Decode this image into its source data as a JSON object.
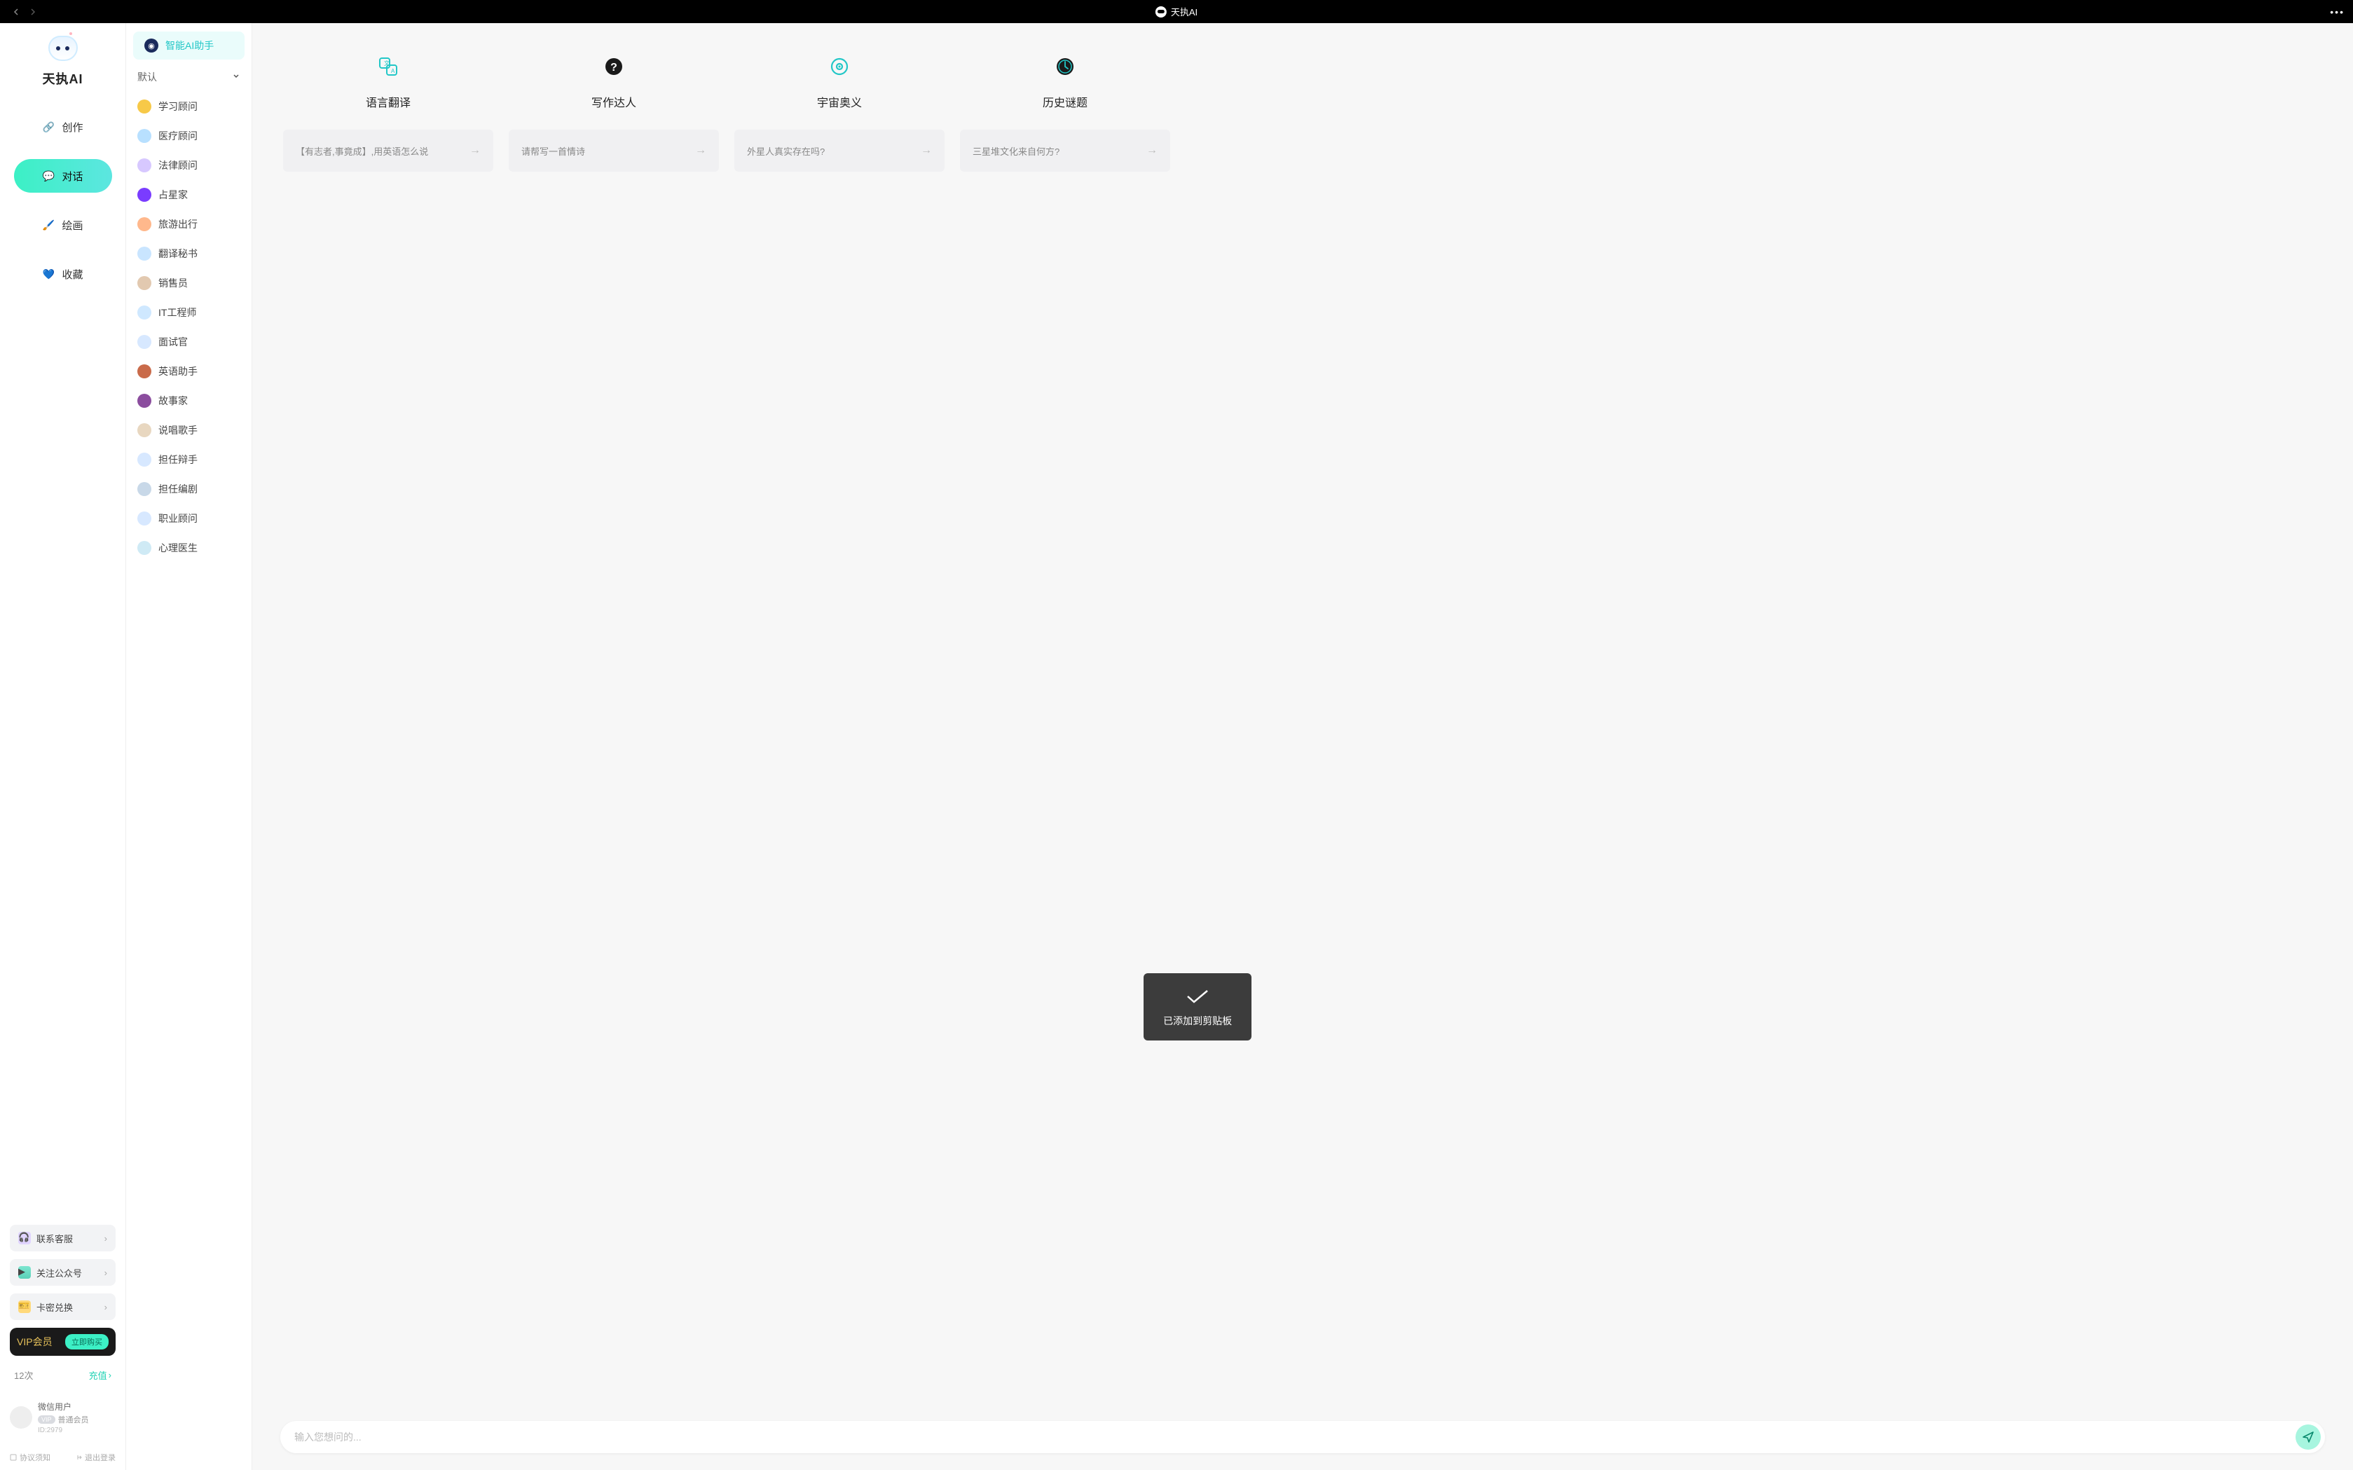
{
  "titlebar": {
    "title": "天执AI"
  },
  "app": {
    "name": "天执AI"
  },
  "nav": {
    "items": [
      {
        "label": "创作",
        "active": false
      },
      {
        "label": "对话",
        "active": true
      },
      {
        "label": "绘画",
        "active": false
      },
      {
        "label": "收藏",
        "active": false
      }
    ]
  },
  "bottom": {
    "contact": "联系客服",
    "follow": "关注公众号",
    "redeem": "卡密兑换",
    "vip_label": "VIP会员",
    "vip_buy": "立即购买",
    "credit": "12次",
    "recharge": "充值"
  },
  "user": {
    "name": "微信用户",
    "level_badge": "VIP",
    "level_text": "普通会员",
    "id": "ID:2979"
  },
  "footer": {
    "terms": "协议须知",
    "logout": "退出登录"
  },
  "assistant_header": "智能AI助手",
  "assistant_group": "默认",
  "assistants": [
    {
      "label": "学习顾问",
      "color": "#f7c948"
    },
    {
      "label": "医疗顾问",
      "color": "#b8e0ff"
    },
    {
      "label": "法律顾问",
      "color": "#d7c8ff"
    },
    {
      "label": "占星家",
      "color": "#7a3cff"
    },
    {
      "label": "旅游出行",
      "color": "#ffb88c"
    },
    {
      "label": "翻译秘书",
      "color": "#c9e5ff"
    },
    {
      "label": "销售员",
      "color": "#e2c9b0"
    },
    {
      "label": "IT工程师",
      "color": "#cfe8ff"
    },
    {
      "label": "面试官",
      "color": "#d7e8ff"
    },
    {
      "label": "英语助手",
      "color": "#c96b4a"
    },
    {
      "label": "故事家",
      "color": "#8b4d9e"
    },
    {
      "label": "说唱歌手",
      "color": "#e8d7c0"
    },
    {
      "label": "担任辩手",
      "color": "#d7e8ff"
    },
    {
      "label": "担任编剧",
      "color": "#c8d8e8"
    },
    {
      "label": "职业顾问",
      "color": "#d7e8ff"
    },
    {
      "label": "心理医生",
      "color": "#cfeaf5"
    }
  ],
  "cards": [
    {
      "title": "语言翻译",
      "prompt": "【有志者,事竟成】,用英语怎么说",
      "icon_color": "#22c7c7"
    },
    {
      "title": "写作达人",
      "prompt": "请帮写一首情诗",
      "icon_color": "#1a1a1a"
    },
    {
      "title": "宇宙奥义",
      "prompt": "外星人真实存在吗?",
      "icon_color": "#22c7c7"
    },
    {
      "title": "历史谜题",
      "prompt": "三星堆文化来自何方?",
      "icon_color": "#1a1a1a"
    }
  ],
  "toast": "已添加到剪贴板",
  "input": {
    "placeholder": "输入您想问的..."
  }
}
